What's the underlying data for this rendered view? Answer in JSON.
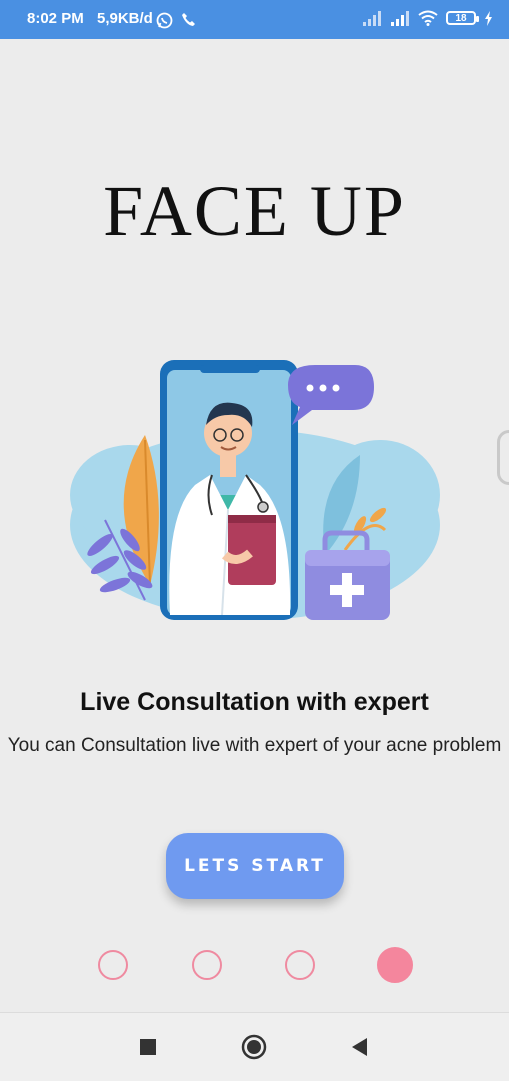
{
  "status_bar": {
    "time": "8:02 PM",
    "net_speed": "5,9KB/d",
    "battery_level": "18"
  },
  "app": {
    "title": "FACE UP"
  },
  "onboarding": {
    "slide_title": "Live Consultation with expert",
    "slide_description": "You can Consultation live with expert of your acne problem",
    "start_button_label": "LETS START",
    "page_count": 4,
    "current_page": 4
  },
  "colors": {
    "status_bar": "#4a90e2",
    "button": "#6f9af0",
    "indicator": "#f4869d",
    "background": "#ececec"
  },
  "icons": {
    "status_left": [
      "whatsapp-icon",
      "phone-icon"
    ],
    "status_right": [
      "signal-icon",
      "signal-icon",
      "wifi-icon",
      "battery-icon",
      "charging-icon"
    ],
    "navigation": [
      "recent-apps-icon",
      "home-icon",
      "back-icon"
    ]
  }
}
